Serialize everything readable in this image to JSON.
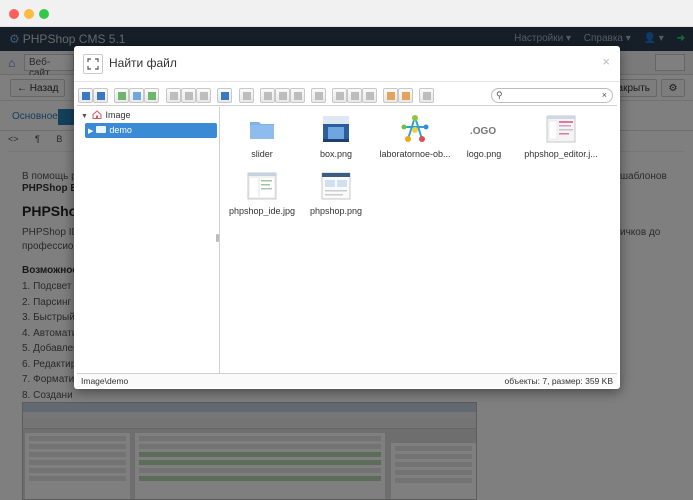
{
  "app": {
    "brand": "PHPShop CMS 5.1",
    "nav_right": [
      "Настройки ▾",
      "Справка ▾",
      "👤 ▾"
    ],
    "site_select": "Веб-сайт",
    "back_label": "← Назад",
    "close_label": "закрыть",
    "tab_main": "Основное",
    "editor_tb_items": [
      "<>",
      "¶",
      "B"
    ]
  },
  "background_doc": {
    "line1": "В помощь р",
    "line1_right": "шаблонов",
    "line2": "PHPShop Ed",
    "heading": "PHPShop",
    "line3": "PHPShop IDE",
    "line3_right": "ичков до",
    "line4": "профессиона",
    "subheading": "Возможност",
    "list": [
      "1. Подсвет",
      "2. Парсинг",
      "3. Быстрый",
      "4. Автомати",
      "5. Добавлен",
      "6. Редактир",
      "7. Формати",
      "8. Создани"
    ]
  },
  "modal": {
    "title": "Найти файл",
    "close": "×",
    "search_placeholder": "",
    "tree": {
      "root": "Image",
      "selected": "demo"
    },
    "files": [
      {
        "name": "slider",
        "type": "folder"
      },
      {
        "name": "box.png",
        "type": "image"
      },
      {
        "name": "laboratornoe-ob...",
        "type": "image"
      },
      {
        "name": "logo.png",
        "type": "image"
      },
      {
        "name": "phpshop_editor.j...",
        "type": "image"
      },
      {
        "name": "phpshop_ide.jpg",
        "type": "image"
      },
      {
        "name": "phpshop.png",
        "type": "image"
      }
    ],
    "status_path": "Image\\demo",
    "status_info": "объекты: 7, размер: 359 KB"
  },
  "colors": {
    "navbar": "#2c3e50",
    "accent": "#2980b9",
    "tree_selected": "#3a8ad6",
    "folder": "#7fb0e6"
  }
}
